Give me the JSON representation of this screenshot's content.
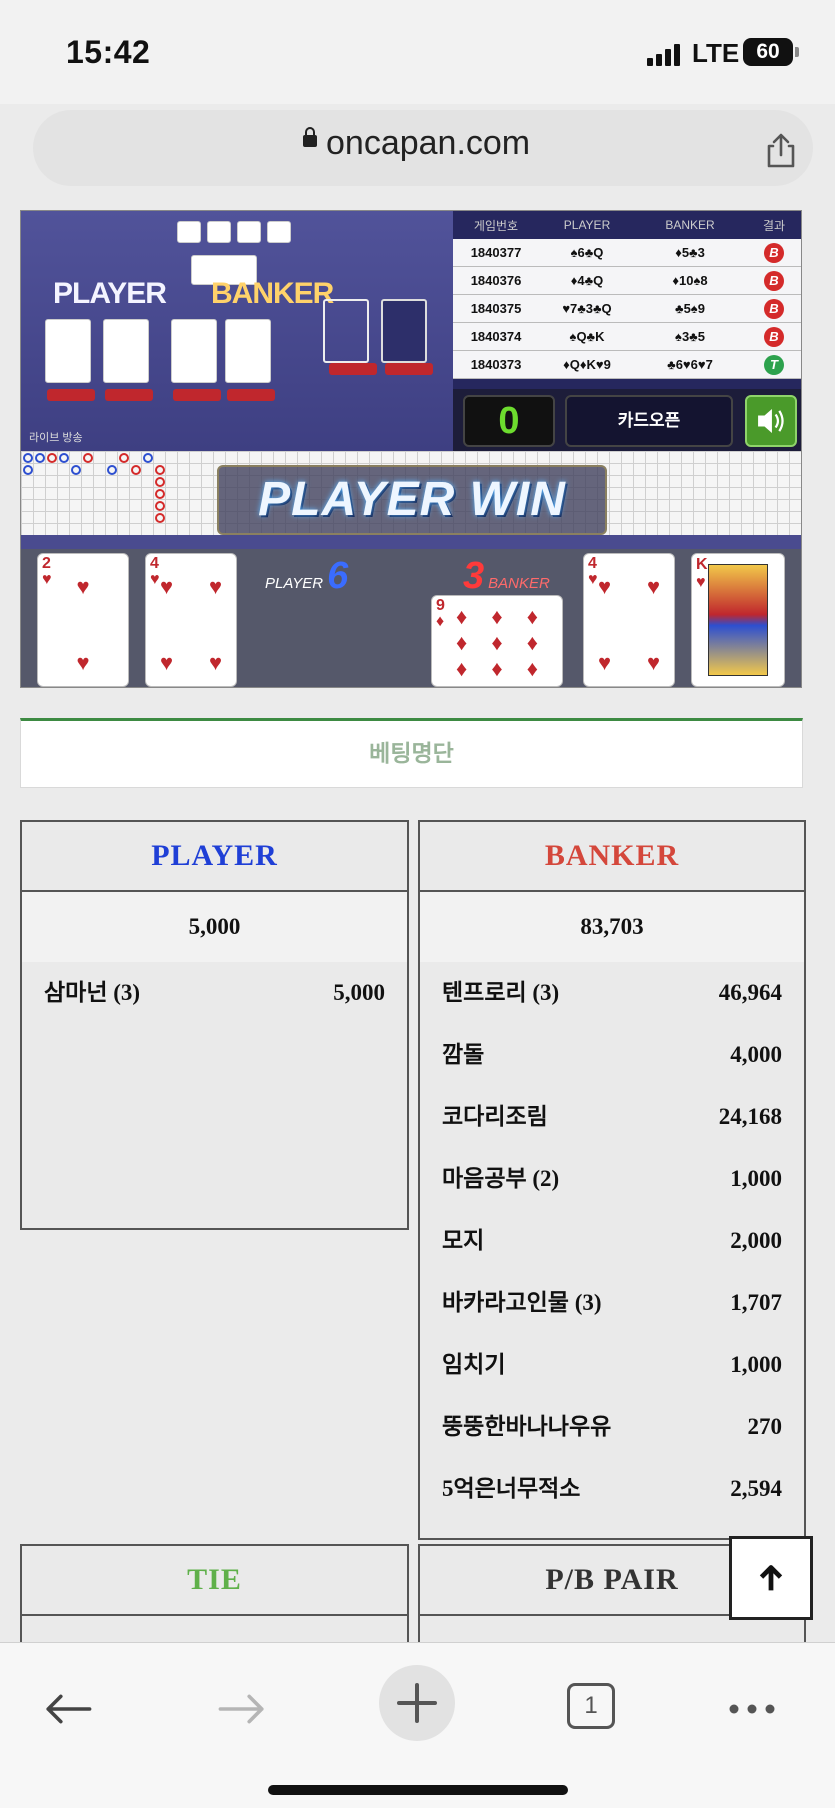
{
  "status_bar": {
    "time": "15:42",
    "network": "LTE",
    "battery": "60"
  },
  "browser": {
    "domain": "oncapan.com",
    "tab_count": "1"
  },
  "game": {
    "table_labels": {
      "player": "PLAYER",
      "banker": "BANKER"
    },
    "live_label": "라이브 방송",
    "history_header": [
      "게임번호",
      "PLAYER",
      "BANKER",
      "결과"
    ],
    "history": [
      {
        "id": "1840377",
        "player": "♠6♣Q",
        "banker": "♦5♣3",
        "result": "B"
      },
      {
        "id": "1840376",
        "player": "♦4♣Q",
        "banker": "♦10♠8",
        "result": "B"
      },
      {
        "id": "1840375",
        "player": "♥7♣3♣Q",
        "banker": "♣5♠9",
        "result": "B"
      },
      {
        "id": "1840374",
        "player": "♠Q♣K",
        "banker": "♠3♣5",
        "result": "B"
      },
      {
        "id": "1840373",
        "player": "♦Q♦K♥9",
        "banker": "♣6♥6♥7",
        "result": "T"
      }
    ],
    "counter": "0",
    "card_open_label": "카드오픈",
    "result_banner": "PLAYER WIN",
    "player_label": "PLAYER",
    "player_score": "6",
    "banker_label": "BANKER",
    "banker_score": "3",
    "player_cards": [
      {
        "rank": "2",
        "suit": "♥"
      },
      {
        "rank": "4",
        "suit": "♥"
      }
    ],
    "banker_cards": [
      {
        "rank": "9",
        "suit": "♦"
      },
      {
        "rank": "4",
        "suit": "♥"
      },
      {
        "rank": "K",
        "suit": "♥"
      }
    ],
    "colors": {
      "player": "#1f3fd6",
      "banker": "#d4473b",
      "tie": "#5fb04a",
      "accent_green": "#3d8a42"
    }
  },
  "betting": {
    "title": "베팅명단",
    "player": {
      "title": "PLAYER",
      "total": "5,000",
      "entries": [
        {
          "name": "삼마넌 (3)",
          "amount": "5,000"
        }
      ]
    },
    "banker": {
      "title": "BANKER",
      "total": "83,703",
      "entries": [
        {
          "name": "텐프로리 (3)",
          "amount": "46,964"
        },
        {
          "name": "깜돌",
          "amount": "4,000"
        },
        {
          "name": "코다리조림",
          "amount": "24,168"
        },
        {
          "name": "마음공부 (2)",
          "amount": "1,000"
        },
        {
          "name": "모지",
          "amount": "2,000"
        },
        {
          "name": "바카라고인물 (3)",
          "amount": "1,707"
        },
        {
          "name": "임치기",
          "amount": "1,000"
        },
        {
          "name": "뚱뚱한바나나우유",
          "amount": "270"
        },
        {
          "name": "5억은너무적소",
          "amount": "2,594"
        }
      ]
    },
    "tie": {
      "title": "TIE"
    },
    "pair": {
      "title": "P/B PAIR"
    }
  }
}
